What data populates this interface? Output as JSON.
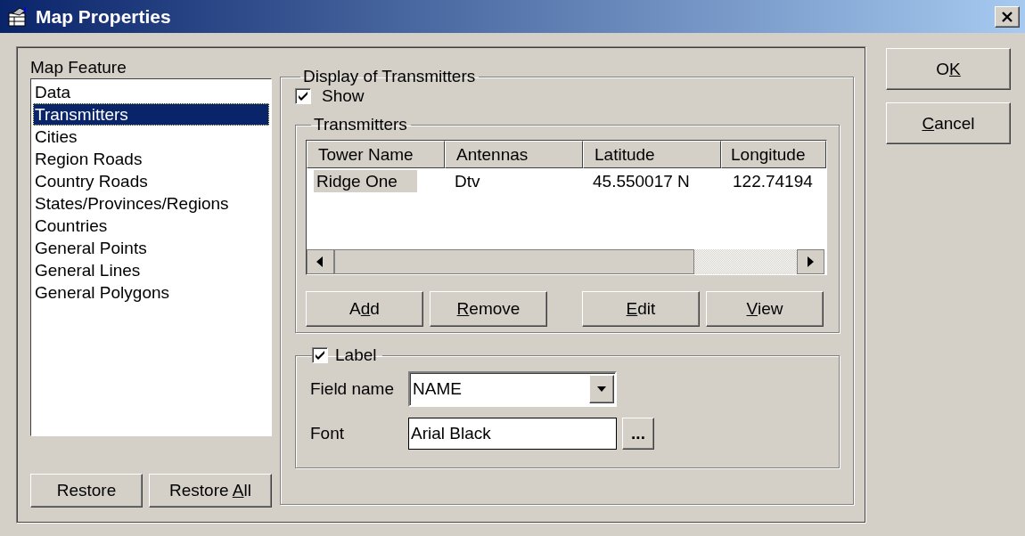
{
  "window": {
    "title": "Map Properties"
  },
  "feature_list": {
    "label": "Map Feature",
    "items": [
      {
        "label": "Data",
        "selected": false
      },
      {
        "label": "Transmitters",
        "selected": true
      },
      {
        "label": "Cities",
        "selected": false
      },
      {
        "label": "Region Roads",
        "selected": false
      },
      {
        "label": "Country Roads",
        "selected": false
      },
      {
        "label": "States/Provinces/Regions",
        "selected": false
      },
      {
        "label": "Countries",
        "selected": false
      },
      {
        "label": "General Points",
        "selected": false
      },
      {
        "label": "General Lines",
        "selected": false
      },
      {
        "label": "General Polygons",
        "selected": false
      }
    ]
  },
  "feature_buttons": [
    {
      "label": [
        {
          "text": "Restore",
          "underline": false
        }
      ]
    },
    {
      "label": [
        {
          "text": "Restore ",
          "underline": false
        },
        {
          "text": "A",
          "underline": true
        },
        {
          "text": "ll",
          "underline": false
        }
      ]
    }
  ],
  "display": {
    "title": "Display of Transmitters",
    "show": {
      "label": "Show",
      "checked": true
    },
    "transmitters": {
      "title": "Transmitters",
      "columns": [
        "Tower Name",
        "Antennas",
        "Latitude",
        "Longitude"
      ],
      "rows": [
        {
          "cells": [
            "Ridge One",
            "Dtv",
            "45.550017 N",
            "122.74194"
          ],
          "selected": true
        }
      ],
      "buttons": [
        {
          "label": [
            {
              "text": "A",
              "underline": false
            },
            {
              "text": "d",
              "underline": true
            },
            {
              "text": "d",
              "underline": false
            }
          ]
        },
        {
          "label": [
            {
              "text": "R",
              "underline": true
            },
            {
              "text": "emove",
              "underline": false
            }
          ]
        },
        {
          "label": [
            {
              "text": "E",
              "underline": true
            },
            {
              "text": "dit",
              "underline": false
            }
          ]
        },
        {
          "label": [
            {
              "text": "V",
              "underline": true
            },
            {
              "text": "iew",
              "underline": false
            }
          ]
        }
      ]
    },
    "label_group": {
      "label": "Label",
      "checked": true,
      "field_name": {
        "label": "Field name",
        "value": "NAME"
      },
      "font": {
        "label": "Font",
        "value": "Arial Black",
        "browse_button": "..."
      }
    }
  },
  "dialog_buttons": [
    {
      "label": [
        {
          "text": "O",
          "underline": false
        },
        {
          "text": "K",
          "underline": true
        }
      ]
    },
    {
      "label": [
        {
          "text": "C",
          "underline": true
        },
        {
          "text": "ancel",
          "underline": false
        }
      ]
    }
  ]
}
